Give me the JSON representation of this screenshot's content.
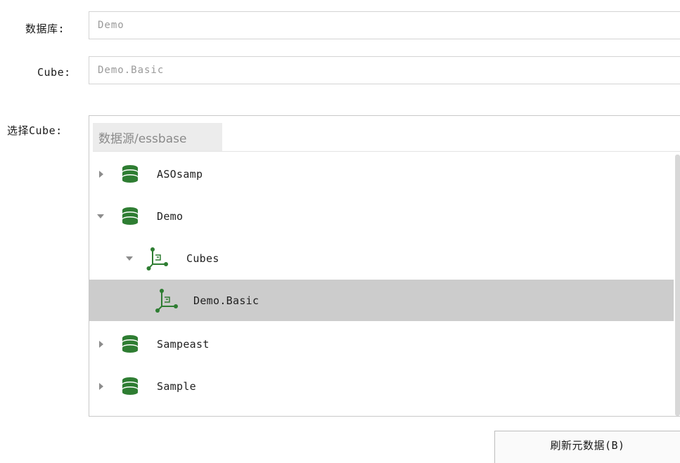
{
  "form": {
    "database_label": "数据库:",
    "database_value": "Demo",
    "cube_label": "Cube:",
    "cube_value": "Demo.Basic",
    "select_cube_label": "选择Cube:"
  },
  "tree": {
    "breadcrumb": "数据源/essbase",
    "items": [
      {
        "label": "ASOsamp",
        "icon": "database-icon",
        "expanded": false,
        "selected": false
      },
      {
        "label": "Demo",
        "icon": "database-icon",
        "expanded": true,
        "selected": false
      },
      {
        "label": "Cubes",
        "icon": "cube-folder-icon",
        "expanded": true,
        "selected": false
      },
      {
        "label": "Demo.Basic",
        "icon": "cube-icon",
        "expanded": null,
        "selected": true
      },
      {
        "label": "Sampeast",
        "icon": "database-icon",
        "expanded": false,
        "selected": false
      },
      {
        "label": "Sample",
        "icon": "database-icon",
        "expanded": false,
        "selected": false
      }
    ]
  },
  "actions": {
    "refresh_label": "刷新元数据(B)"
  },
  "colors": {
    "icon_green": "#2e7d32",
    "selected_row": "#cccccc",
    "toggle_gray": "#8c8c8c"
  }
}
